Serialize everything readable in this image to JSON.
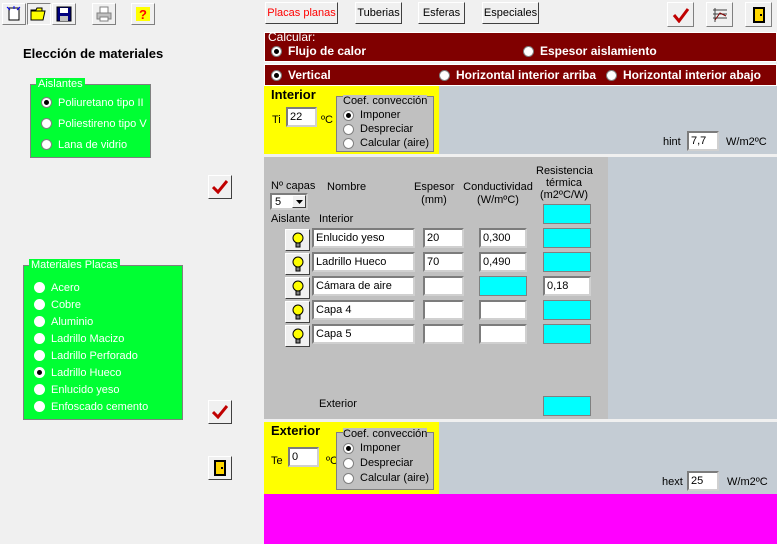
{
  "toolbar": {
    "tabs": [
      "Placas planas",
      "Tuberias",
      "Esferas",
      "Especiales"
    ]
  },
  "left": {
    "title": "Elección de materiales",
    "aislantes": {
      "title": "Aislantes",
      "options": [
        "Poliuretano tipo II",
        "Poliestireno tipo V",
        "Lana de vidrio"
      ],
      "selected": 0
    },
    "placas": {
      "title": "Materiales Placas",
      "options": [
        "Acero",
        "Cobre",
        "Aluminio",
        "Ladrillo Macizo",
        "Ladrillo Perforado",
        "Ladrillo Hueco",
        "Enlucido yeso",
        "Enfoscado cemento"
      ],
      "selected": 5
    }
  },
  "calc": {
    "title": "Calcular:",
    "option1": "Flujo de calor",
    "option2": "Espesor aislamiento",
    "orient": [
      "Vertical",
      "Horizontal interior arriba",
      "Horizontal interior abajo"
    ]
  },
  "interior": {
    "title": "Interior",
    "t_label": "Ti",
    "t_value": "22",
    "t_unit": "ºC",
    "coef_title": "Coef. convección",
    "coef_options": [
      "Imponer",
      "Despreciar",
      "Calcular (aire)"
    ],
    "h_label": "hint",
    "h_value": "7,7",
    "h_unit": "W/m2ºC"
  },
  "layers": {
    "ncapas_label": "Nº capas",
    "ncapas_value": "5",
    "col_nombre": "Nombre",
    "col_espesor": "Espesor (mm)",
    "col_cond": "Conductividad (W/mºC)",
    "col_res": "Resistencia térmica (m2ºC/W)",
    "aislante_label": "Aislante",
    "interior_label": "Interior",
    "exterior_label": "Exterior",
    "rows": [
      {
        "name": "Enlucido yeso",
        "espesor": "20",
        "cond": "0,300",
        "res": ""
      },
      {
        "name": "Ladrillo Hueco",
        "espesor": "70",
        "cond": "0,490",
        "res": ""
      },
      {
        "name": "Cámara de aire",
        "espesor": "",
        "cond": "",
        "res": "0,18"
      },
      {
        "name": "Capa 4",
        "espesor": "",
        "cond": "",
        "res": ""
      },
      {
        "name": "Capa 5",
        "espesor": "",
        "cond": "",
        "res": ""
      }
    ]
  },
  "exterior": {
    "title": "Exterior",
    "t_label": "Te",
    "t_value": "0",
    "t_unit": "ºC",
    "coef_title": "Coef. convección",
    "coef_options": [
      "Imponer",
      "Despreciar",
      "Calcular (aire)"
    ],
    "h_label": "hext",
    "h_value": "25",
    "h_unit": "W/m2ºC"
  },
  "colors": {
    "green": "#00ff33",
    "maroon": "#800000",
    "yellow": "#ffff00",
    "magenta": "#ff00ff",
    "cyan": "#00ffff",
    "gray_panel": "#c0c0c0"
  }
}
